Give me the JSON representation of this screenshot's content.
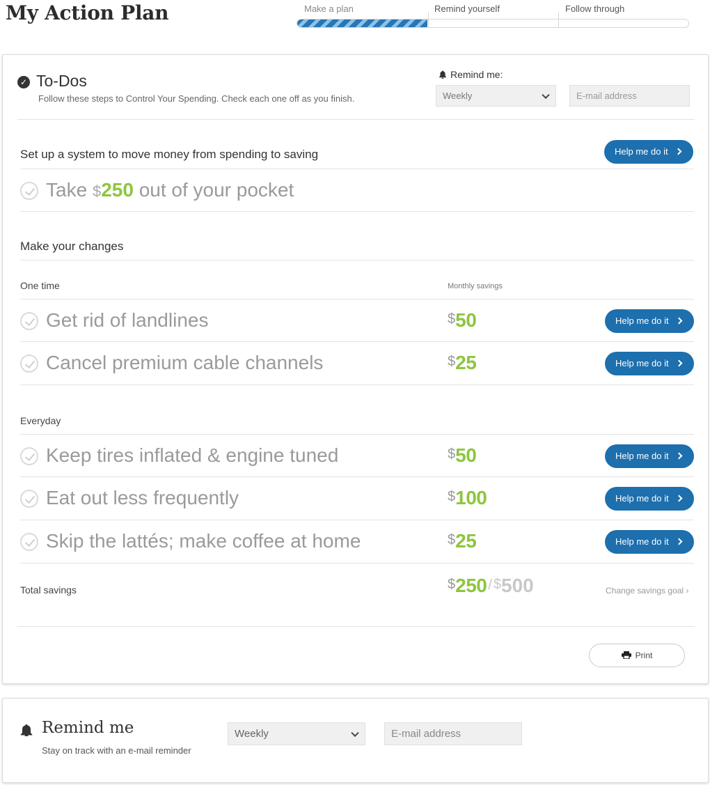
{
  "header": {
    "title": "My Action Plan",
    "steps": [
      "Make a plan",
      "Remind yourself",
      "Follow through"
    ],
    "progress_fraction": 0.3333
  },
  "todos": {
    "icon": "check-circle-icon",
    "title": "To-Dos",
    "subtitle": "Follow these steps to Control Your Spending. Check each one off as you finish.",
    "remind_label": "Remind me:",
    "frequency": "Weekly",
    "email_placeholder": "E-mail address"
  },
  "system": {
    "heading": "Set up a system to move money from spending to saving",
    "help_label": "Help me do it",
    "task_prefix": "Take",
    "task_currency": "$",
    "task_amount": "250",
    "task_suffix": "out of your pocket"
  },
  "changes": {
    "heading": "Make your changes",
    "one_time_label": "One time",
    "monthly_savings_label": "Monthly savings",
    "one_time": [
      {
        "task": "Get rid of landlines",
        "currency": "$",
        "amount": "50",
        "help": "Help me do it"
      },
      {
        "task": "Cancel premium cable channels",
        "currency": "$",
        "amount": "25",
        "help": "Help me do it"
      }
    ],
    "everyday_label": "Everyday",
    "everyday": [
      {
        "task": "Keep tires inflated & engine tuned",
        "currency": "$",
        "amount": "50",
        "help": "Help me do it"
      },
      {
        "task": "Eat out less frequently",
        "currency": "$",
        "amount": "100",
        "help": "Help me do it"
      },
      {
        "task": "Skip the lattés; make coffee at home",
        "currency": "$",
        "amount": "25",
        "help": "Help me do it"
      }
    ]
  },
  "total": {
    "label": "Total savings",
    "currency": "$",
    "amount": "250",
    "separator": "/",
    "goal_currency": "$",
    "goal": "500",
    "change_goal": "Change savings goal ›"
  },
  "print_label": "Print",
  "remind": {
    "icon": "bell-icon",
    "title": "Remind me",
    "subtitle": "Stay on track with an e-mail reminder",
    "frequency": "Weekly",
    "email_placeholder": "E-mail address"
  },
  "colors": {
    "accent_blue": "#1d6fad",
    "savings_green": "#8cc63f"
  }
}
